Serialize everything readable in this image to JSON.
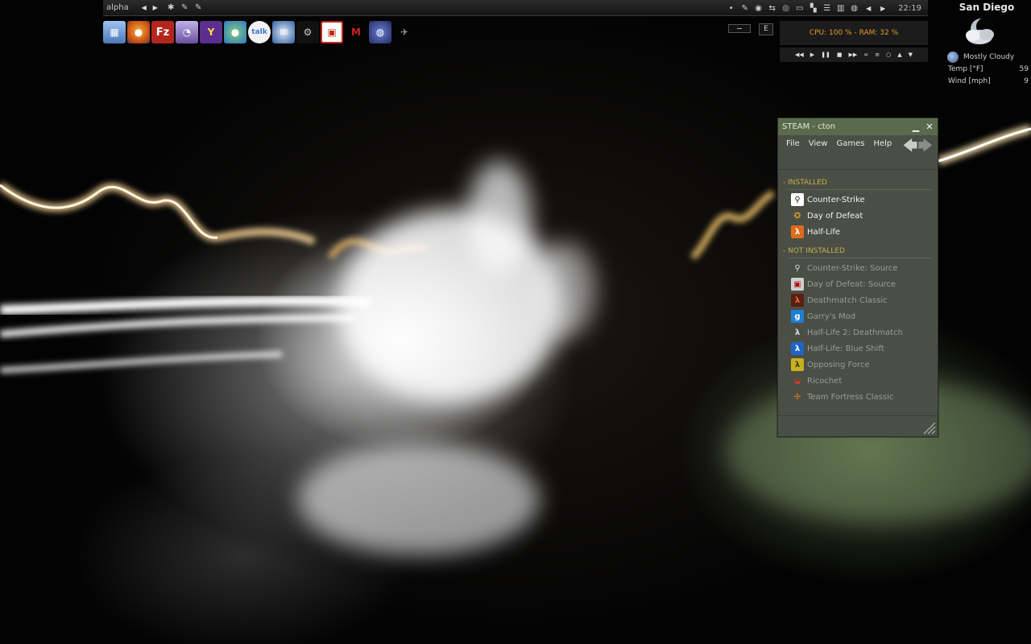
{
  "topbar": {
    "workspace": "alpha",
    "prev_label": "◀",
    "next_label": "▶",
    "left_tray": [
      "wrench-icon",
      "wrench-icon",
      "wrench-icon"
    ],
    "right_tray": [
      "wrench-icon",
      "steam-icon",
      "network-icon",
      "disk-icon",
      "monitor-icon",
      "window-icon",
      "battery-icon",
      "audio-icon",
      "tools-icon"
    ],
    "clock": "22:19"
  },
  "launcher": {
    "apps": [
      {
        "name": "computer",
        "color": "#5a7fb8",
        "glyph": "▦"
      },
      {
        "name": "firefox",
        "color": "#d86a1f",
        "glyph": "●"
      },
      {
        "name": "filezilla",
        "color": "#b3261e",
        "glyph": "Fz"
      },
      {
        "name": "gaim",
        "color": "#7a5fa8",
        "glyph": "◔"
      },
      {
        "name": "yahoo-messenger",
        "color": "#5b2f8f",
        "glyph": "Y"
      },
      {
        "name": "windows-messenger",
        "color": "#3c7ec4",
        "glyph": "●"
      },
      {
        "name": "google-talk",
        "color": "#e8e8e8",
        "glyph": "talk"
      },
      {
        "name": "thunderbird",
        "color": "#2f5f9e",
        "glyph": "✉"
      },
      {
        "name": "steam",
        "color": "#111111",
        "glyph": "⚙"
      },
      {
        "name": "app-red-square",
        "color": "#c0281a",
        "glyph": "▣"
      },
      {
        "name": "mario",
        "color": "#b81c1c",
        "glyph": "M"
      },
      {
        "name": "ball",
        "color": "#3a4fa0",
        "glyph": "◍"
      },
      {
        "name": "aircraft",
        "color": "#555b4a",
        "glyph": "✈"
      }
    ]
  },
  "widgets": {
    "e_button": "E",
    "sysmon": "CPU: 100 % - RAM: 32 %",
    "media_controls": [
      "◀◀",
      "▶",
      "❚❚",
      "■",
      "▶▶",
      "≍",
      "≡",
      "○",
      "▲",
      "▼"
    ]
  },
  "weather": {
    "city": "San Diego",
    "condition": "Mostly Cloudy",
    "temp_label": "Temp [°F]",
    "temp_value": "59",
    "wind_label": "Wind [mph]",
    "wind_value": "9"
  },
  "steam": {
    "title": "STEAM - cton",
    "menu": [
      "File",
      "View",
      "Games",
      "Help"
    ],
    "installed_header": "-  INSTALLED",
    "installed": [
      {
        "name": "Counter-Strike",
        "icon": "cs-icon",
        "bg": "#ffffff",
        "fg": "#222222",
        "glyph": "⚲"
      },
      {
        "name": "Day of Defeat",
        "icon": "dod-icon",
        "bg": "#4a4e45",
        "fg": "#e0a02a",
        "glyph": "✪"
      },
      {
        "name": "Half-Life",
        "icon": "halflife-icon",
        "bg": "#e06a1a",
        "fg": "#ffffff",
        "glyph": "λ"
      }
    ],
    "notinstalled_header": "-  NOT INSTALLED",
    "notinstalled": [
      {
        "name": "Counter-Strike: Source",
        "icon": "css-icon",
        "bg": "#4a4e45",
        "fg": "#d8d8d8",
        "glyph": "⚲"
      },
      {
        "name": "Day of Defeat: Source",
        "icon": "dods-icon",
        "bg": "#d0d0d0",
        "fg": "#b01010",
        "glyph": "▣"
      },
      {
        "name": "Deathmatch Classic",
        "icon": "dmc-icon",
        "bg": "#5a2010",
        "fg": "#e07030",
        "glyph": "λ"
      },
      {
        "name": "Garry's Mod",
        "icon": "gmod-icon",
        "bg": "#1e7fd4",
        "fg": "#ffffff",
        "glyph": "g"
      },
      {
        "name": "Half-Life 2: Deathmatch",
        "icon": "hl2dm-icon",
        "bg": "#4a4e45",
        "fg": "#dddddd",
        "glyph": "λ"
      },
      {
        "name": "Half-Life: Blue Shift",
        "icon": "blueshift-icon",
        "bg": "#1f64c8",
        "fg": "#ffffff",
        "glyph": "λ"
      },
      {
        "name": "Opposing Force",
        "icon": "opfor-icon",
        "bg": "#c8b020",
        "fg": "#3a3a10",
        "glyph": "λ"
      },
      {
        "name": "Ricochet",
        "icon": "ricochet-icon",
        "bg": "#4a4e45",
        "fg": "#d03a2a",
        "glyph": "◒"
      },
      {
        "name": "Team Fortress Classic",
        "icon": "tfc-icon",
        "bg": "#4a4e45",
        "fg": "#d07a20",
        "glyph": "✣"
      }
    ]
  }
}
